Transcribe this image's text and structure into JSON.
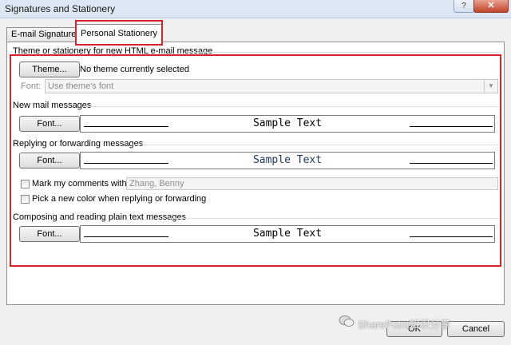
{
  "window": {
    "title": "Signatures and Stationery",
    "help_glyph": "?",
    "close_glyph": "✕"
  },
  "tabs": {
    "email_signature": "E-mail Signature",
    "personal_stationery": "Personal Stationery"
  },
  "theme_section": {
    "heading": "Theme or stationery for new HTML e-mail message",
    "theme_button": "Theme...",
    "theme_status": "No theme currently selected",
    "font_label": "Font:",
    "font_select_value": "Use theme's font"
  },
  "new_mail": {
    "heading": "New mail messages",
    "font_button": "Font...",
    "sample_text": "Sample Text",
    "sample_color": "#000000"
  },
  "replying": {
    "heading": "Replying or forwarding messages",
    "font_button": "Font...",
    "sample_text": "Sample Text",
    "sample_color": "#1f3864",
    "mark_comments_label": "Mark my comments with:",
    "mark_comments_checked": false,
    "mark_comments_value": "Zhang, Benny",
    "new_color_label": "Pick a new color when replying or forwarding",
    "new_color_checked": false
  },
  "plain_text": {
    "heading": "Composing and reading plain text messages",
    "font_button": "Font...",
    "sample_text": "Sample Text",
    "sample_color": "#000000"
  },
  "footer": {
    "ok_label": "OK",
    "cancel_label": "Cancel",
    "watermark": "SharePoint知识分享"
  },
  "colors": {
    "highlight": "#d9242c",
    "titlebar": "#dde7f3"
  }
}
